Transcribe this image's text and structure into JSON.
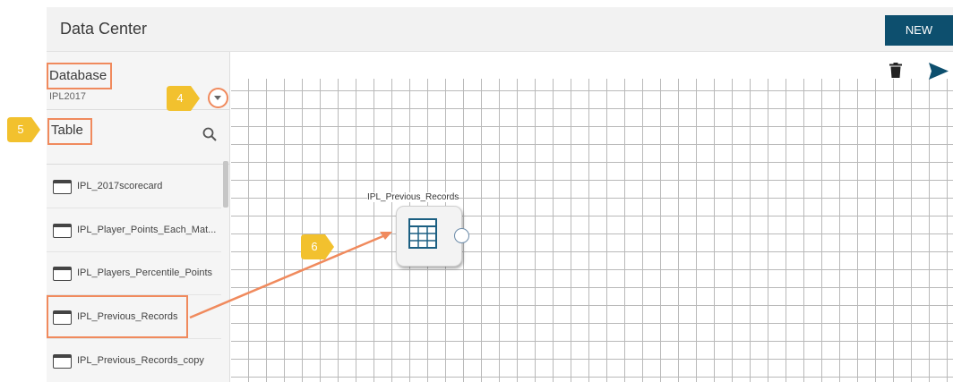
{
  "header": {
    "title": "Data Center",
    "new_button": "NEW"
  },
  "sidebar": {
    "database_label": "Database",
    "database_value": "IPL2017",
    "table_label": "Table",
    "tables": [
      {
        "label": "IPL_2017scorecard"
      },
      {
        "label": "IPL_Player_Points_Each_Mat..."
      },
      {
        "label": "IPL_Players_Percentile_Points"
      },
      {
        "label": "IPL_Previous_Records"
      },
      {
        "label": "IPL_Previous_Records_copy"
      }
    ]
  },
  "canvas": {
    "node_title": "IPL_Previous_Records"
  },
  "callouts": {
    "c4": "4",
    "c5": "5",
    "c6": "6"
  },
  "icons": {
    "search": "search-icon",
    "trash": "trash-icon",
    "send": "send-icon",
    "dropdown": "chevron-down-icon",
    "table": "table-icon"
  },
  "colors": {
    "accent_button": "#0d4f6e",
    "highlight": "#f08a5d",
    "callout": "#f2c12e"
  }
}
